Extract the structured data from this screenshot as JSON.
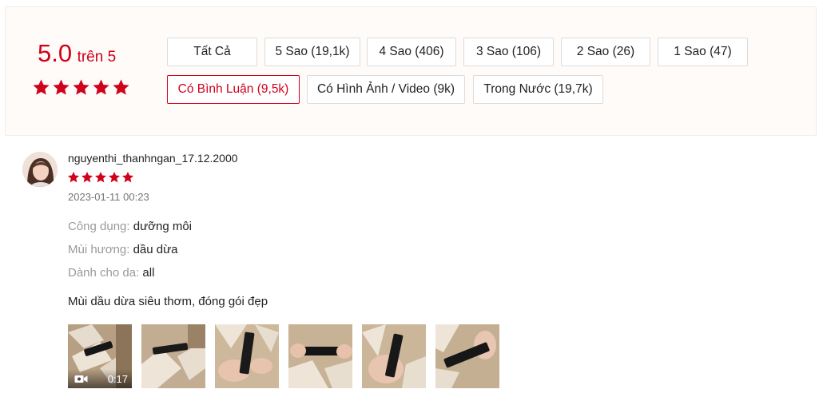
{
  "overview": {
    "score": "5.0",
    "score_suffix": "trên 5",
    "star_color": "#d0011b",
    "filters": [
      {
        "label": "Tất Cả",
        "active": false
      },
      {
        "label": "5 Sao (19,1k)",
        "active": false
      },
      {
        "label": "4 Sao (406)",
        "active": false
      },
      {
        "label": "3 Sao (106)",
        "active": false
      },
      {
        "label": "2 Sao (26)",
        "active": false
      },
      {
        "label": "1 Sao (47)",
        "active": false
      },
      {
        "label": "Có Bình Luận (9,5k)",
        "active": true
      },
      {
        "label": "Có Hình Ảnh / Video (9k)",
        "active": false
      },
      {
        "label": "Trong Nước (19,7k)",
        "active": false
      }
    ]
  },
  "review": {
    "username": "nguyenthi_thanhngan_17.12.2000",
    "rating": 5,
    "datetime": "2023-01-11 00:23",
    "attributes": [
      {
        "key": "Công dụng:",
        "value": "dưỡng môi"
      },
      {
        "key": "Mùi hương:",
        "value": "dầu dừa"
      },
      {
        "key": "Dành cho da:",
        "value": "all"
      }
    ],
    "comment": "Mùi dầu dừa siêu thơm, đóng gói đẹp",
    "media": [
      {
        "type": "video",
        "duration": "0:17",
        "icon": "video-camera-icon"
      },
      {
        "type": "image"
      },
      {
        "type": "image"
      },
      {
        "type": "image"
      },
      {
        "type": "image"
      },
      {
        "type": "image"
      }
    ]
  }
}
